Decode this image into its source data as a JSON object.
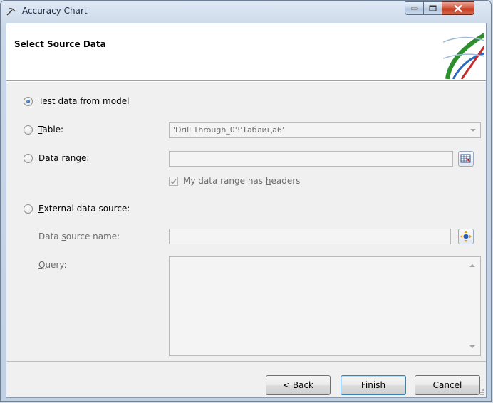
{
  "window": {
    "title": "Accuracy Chart",
    "icon": "pickaxe-icon"
  },
  "header": {
    "heading": "Select Source Data"
  },
  "options": {
    "test_data": {
      "prefix": "Test data from ",
      "access": "m",
      "suffix": "odel",
      "selected": true
    },
    "table": {
      "prefix": "",
      "access": "T",
      "suffix": "able:",
      "selected": false,
      "value": "'Drill Through_0'!'Таблица6'"
    },
    "data_range": {
      "prefix": "",
      "access": "D",
      "suffix": "ata range:",
      "selected": false,
      "value": "",
      "headers_checkbox": {
        "prefix": "My data range has ",
        "access": "h",
        "suffix": "eaders",
        "checked": true
      }
    },
    "external": {
      "prefix": "",
      "access": "E",
      "suffix": "xternal data source:",
      "selected": false,
      "source_name": {
        "prefix": "Data ",
        "access": "s",
        "suffix": "ource name:",
        "value": ""
      },
      "query": {
        "prefix": "",
        "access": "Q",
        "suffix": "uery:",
        "value": ""
      }
    }
  },
  "buttons": {
    "back": {
      "prefix": "< ",
      "access": "B",
      "suffix": "ack"
    },
    "finish": "Finish",
    "cancel": "Cancel"
  }
}
